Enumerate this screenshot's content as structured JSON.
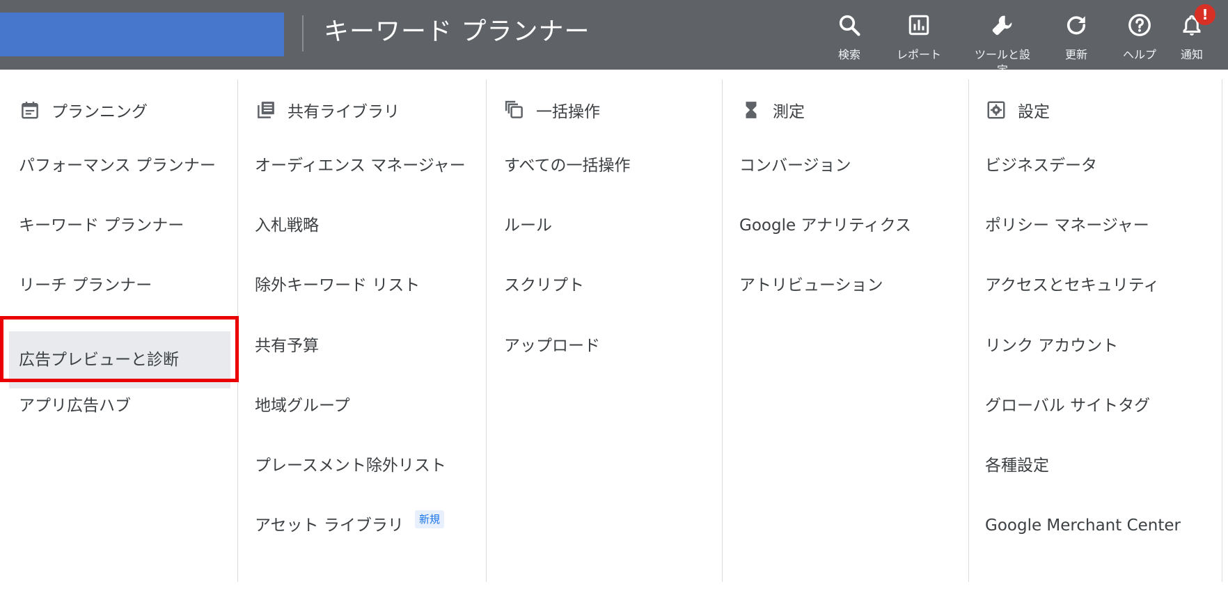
{
  "header": {
    "title": "キーワード プランナー",
    "nav": [
      {
        "name": "search",
        "label": "検索",
        "icon": "search-icon"
      },
      {
        "name": "report",
        "label": "レポート",
        "icon": "bar-chart-icon"
      },
      {
        "name": "tools",
        "label": "ツールと設定",
        "icon": "wrench-icon"
      },
      {
        "name": "refresh",
        "label": "更新",
        "icon": "refresh-icon"
      },
      {
        "name": "help",
        "label": "ヘルプ",
        "icon": "help-icon"
      },
      {
        "name": "notifications",
        "label": "通知",
        "icon": "bell-icon",
        "badge": "!"
      }
    ]
  },
  "colors": {
    "topbar": "#5f6368",
    "brand_block": "#4677cc",
    "highlight": "#ea0000",
    "badge": "#d93025",
    "new_badge_text": "#1a73e8"
  },
  "menu": {
    "columns": [
      {
        "header": "プランニング",
        "icon": "calendar-icon",
        "items": [
          "パフォーマンス プランナー",
          "キーワード プランナー",
          "リーチ プランナー",
          "広告プレビューと診断",
          "アプリ広告ハブ"
        ]
      },
      {
        "header": "共有ライブラリ",
        "icon": "library-icon",
        "items": [
          "オーディエンス マネージャー",
          "入札戦略",
          "除外キーワード リスト",
          "共有予算",
          "地域グループ",
          "プレースメント除外リスト",
          "アセット ライブラリ"
        ],
        "new_badge": "新規"
      },
      {
        "header": "一括操作",
        "icon": "copy-icon",
        "items": [
          "すべての一括操作",
          "ルール",
          "スクリプト",
          "アップロード"
        ]
      },
      {
        "header": "測定",
        "icon": "hourglass-icon",
        "items": [
          "コンバージョン",
          "Google アナリティクス",
          "アトリビューション"
        ]
      },
      {
        "header": "設定",
        "icon": "settings-icon",
        "items": [
          "ビジネスデータ",
          "ポリシー マネージャー",
          "アクセスとセキュリティ",
          "リンク アカウント",
          "グローバル サイトタグ",
          "各種設定",
          "Google Merchant Center"
        ]
      }
    ]
  }
}
